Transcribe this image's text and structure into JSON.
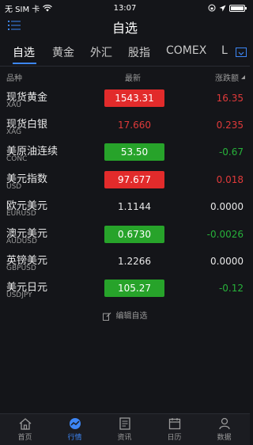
{
  "status": {
    "carrier": "无 SIM 卡",
    "time": "13:07"
  },
  "nav": {
    "title": "自选"
  },
  "tabs": [
    {
      "label": "自选"
    },
    {
      "label": "黄金"
    },
    {
      "label": "外汇"
    },
    {
      "label": "股指"
    },
    {
      "label": "COMEX"
    },
    {
      "label": "L"
    }
  ],
  "columns": {
    "name": "品种",
    "latest": "最新",
    "change": "涨跌额"
  },
  "rows": [
    {
      "name": "现货黄金",
      "code": "XAU",
      "price": "1543.31",
      "change": "16.35",
      "style": "up-box",
      "chg": "up"
    },
    {
      "name": "现货白银",
      "code": "XAG",
      "price": "17.660",
      "change": "0.235",
      "style": "up-text",
      "chg": "up"
    },
    {
      "name": "美原油连续",
      "code": "CONC",
      "price": "53.50",
      "change": "-0.67",
      "style": "down-box",
      "chg": "down"
    },
    {
      "name": "美元指数",
      "code": "USD",
      "price": "97.677",
      "change": "0.018",
      "style": "up-box",
      "chg": "up"
    },
    {
      "name": "欧元美元",
      "code": "EURUSD",
      "price": "1.1144",
      "change": "0.0000",
      "style": "flat-text",
      "chg": "flat"
    },
    {
      "name": "澳元美元",
      "code": "AUDUSD",
      "price": "0.6730",
      "change": "-0.0026",
      "style": "down-box",
      "chg": "down"
    },
    {
      "name": "英镑美元",
      "code": "GBPUSD",
      "price": "1.2266",
      "change": "0.0000",
      "style": "flat-text",
      "chg": "flat"
    },
    {
      "name": "美元日元",
      "code": "USDJPY",
      "price": "105.27",
      "change": "-0.12",
      "style": "down-box",
      "chg": "down"
    }
  ],
  "edit_label": "编辑自选",
  "bottom_tabs": [
    {
      "label": "首页",
      "icon": "home-icon"
    },
    {
      "label": "行情",
      "icon": "market-icon"
    },
    {
      "label": "资讯",
      "icon": "news-icon"
    },
    {
      "label": "日历",
      "icon": "calendar-icon"
    },
    {
      "label": "数据",
      "icon": "data-icon"
    }
  ],
  "colors": {
    "accent": "#3d86f5",
    "up": "#e22b2b",
    "down": "#27a32a"
  }
}
